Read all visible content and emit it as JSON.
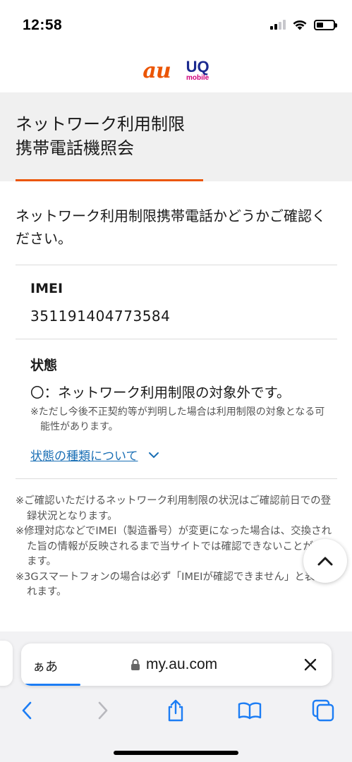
{
  "status_bar": {
    "time": "12:58"
  },
  "brand": {
    "au_logo": "au",
    "uq_logo_top": "UQ",
    "uq_logo_sub": "mobile",
    "colors": {
      "au": "#eb5505",
      "uq": "#1b2a8f",
      "uq_sub": "#d0007a"
    }
  },
  "page": {
    "title_line1": "ネットワーク利用制限",
    "title_line2": "携帯電話機照会",
    "intro": "ネットワーク利用制限携帯電話かどうかご確認ください。",
    "accent_color": "#eb5505"
  },
  "imei": {
    "label": "IMEI",
    "value": "351191404773584"
  },
  "status": {
    "label": "状態",
    "result": "〇：ネットワーク利用制限の対象外です。",
    "note": "※ただし今後不正契約等が判明した場合は利用制限の対象となる可能性があります。",
    "link": "状態の種類について"
  },
  "footnotes": [
    "※ご確認いただけるネットワーク利用制限の状況はご確認前日での登録状況となります。",
    "※修理対応などでIMEI（製造番号）が変更になった場合は、交換された旨の情報が反映されるまで当サイトでは確認できないことがあります。",
    "※3Gスマートフォンの場合は必ず「IMEIが確認できません」と表記されます。"
  ],
  "browser": {
    "aa_label": "ぁあ",
    "url": "my.au.com",
    "load_progress": 0.19,
    "icons": [
      "back-icon",
      "forward-icon",
      "share-icon",
      "bookmarks-icon",
      "tabs-icon",
      "lock-icon",
      "close-icon",
      "chevron-up-icon"
    ]
  }
}
